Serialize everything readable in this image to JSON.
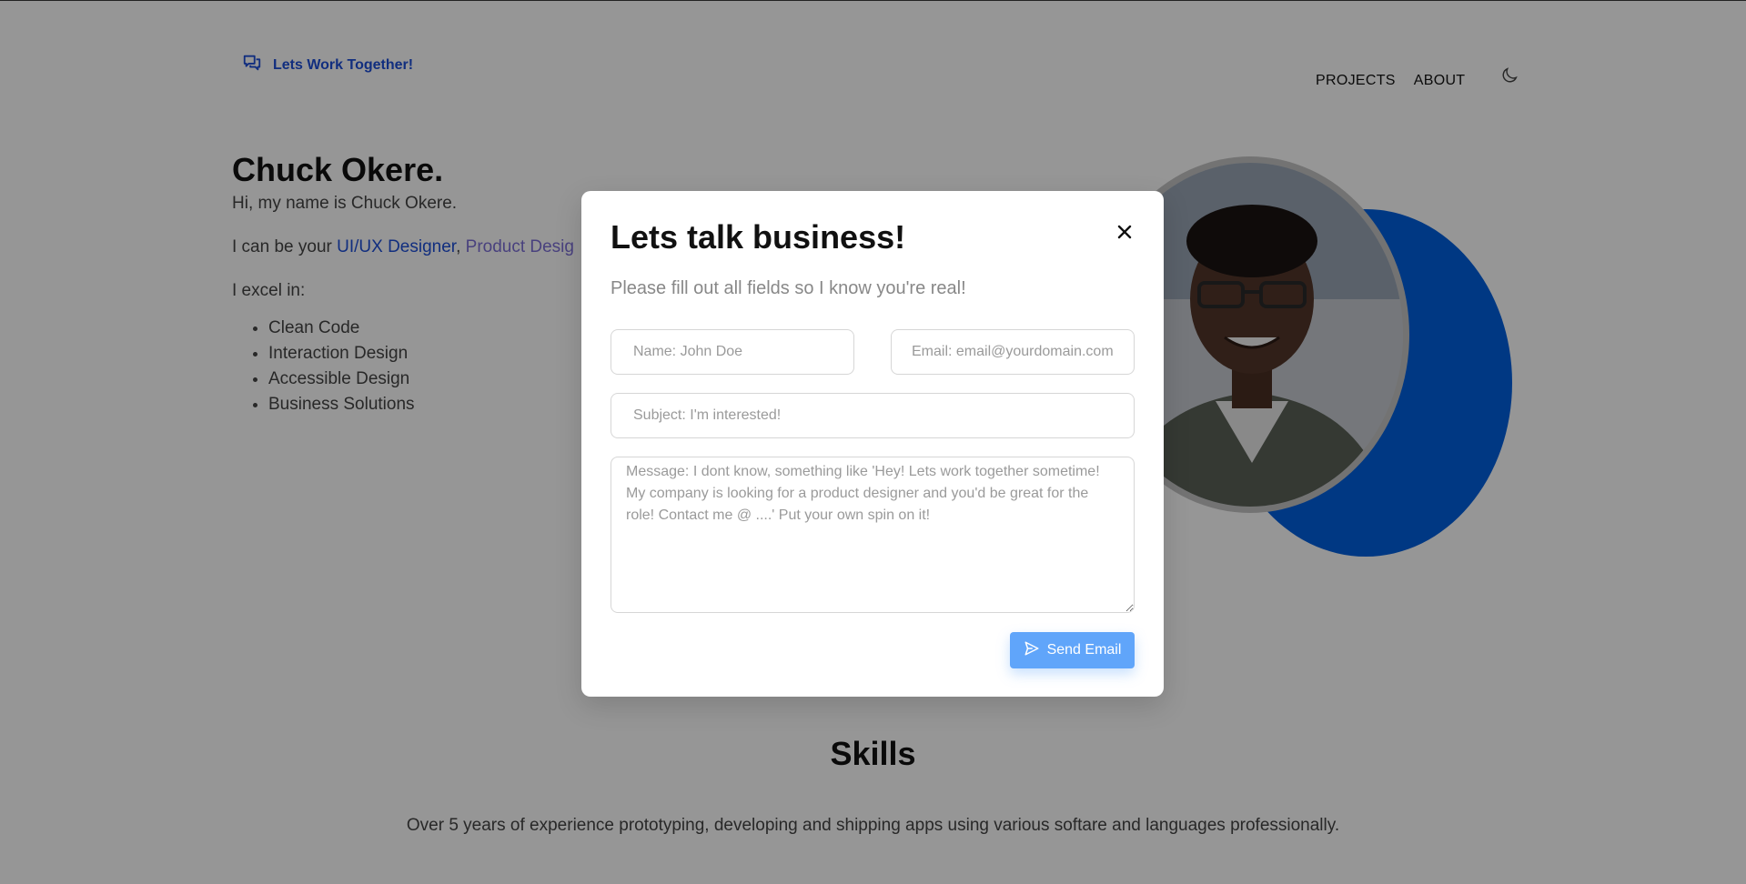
{
  "header": {
    "brand_label": "Lets Work Together!",
    "nav": [
      {
        "label": "PROJECTS"
      },
      {
        "label": "ABOUT"
      }
    ]
  },
  "hero": {
    "name": "Chuck Okere.",
    "intro": "Hi, my name is Chuck Okere.",
    "roles_prefix": "I can be your ",
    "roles": [
      "UI/UX Designer",
      "Product Desig"
    ],
    "excel_label": "I excel in:",
    "skills": [
      "Clean Code",
      "Interaction Design",
      "Accessible Design",
      "Business Solutions"
    ]
  },
  "skills_section": {
    "title": "Skills",
    "description": "Over 5 years of experience prototyping, developing and shipping apps using various softare and languages professionally."
  },
  "modal": {
    "title": "Lets talk business!",
    "subtitle": "Please fill out all fields so I know you're real!",
    "name_placeholder": "Name: John Doe",
    "email_placeholder": "Email: email@yourdomain.com",
    "subject_placeholder": "Subject: I'm interested!",
    "message_placeholder": "Message: I dont know, something like 'Hey! Lets work together sometime! My company is looking for a product designer and you'd be great for the role! Contact me @ ....' Put your own spin on it!",
    "send_label": "Send Email"
  },
  "colors": {
    "accent": "#1d4ed8",
    "send_button": "#60a5fa",
    "blob": "#0060df"
  }
}
